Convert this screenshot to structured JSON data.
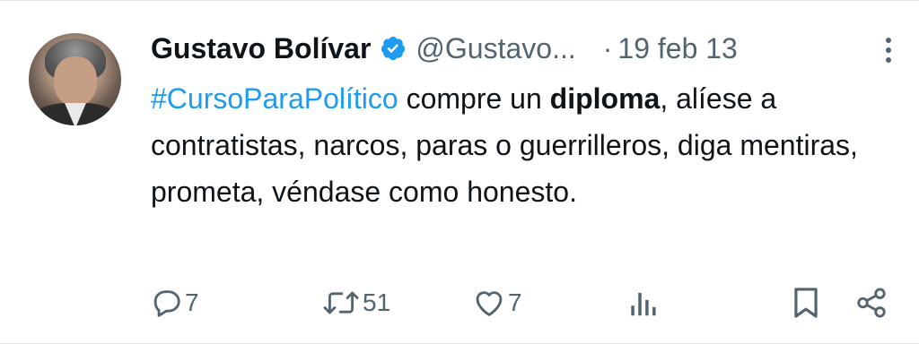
{
  "tweet": {
    "author_name": "Gustavo Bolívar",
    "handle": "@Gustavo...",
    "separator": "·",
    "date": "19 feb 13",
    "text": {
      "hashtag": "#CursoParaPolítico",
      "part1": " compre un ",
      "bold": "diploma",
      "part2": ", alíese a contratistas, narcos, paras o guerrilleros, diga mentiras, prometa, véndase como honesto."
    },
    "actions": {
      "reply_count": "7",
      "retweet_count": "51",
      "like_count": "7"
    }
  },
  "colors": {
    "link": "#1d9bf0",
    "secondary_text": "#536471",
    "primary_text": "#0f1419"
  },
  "icons": [
    "verified-badge-icon",
    "more-icon",
    "reply-icon",
    "retweet-icon",
    "like-icon",
    "views-icon",
    "bookmark-icon",
    "share-icon"
  ]
}
